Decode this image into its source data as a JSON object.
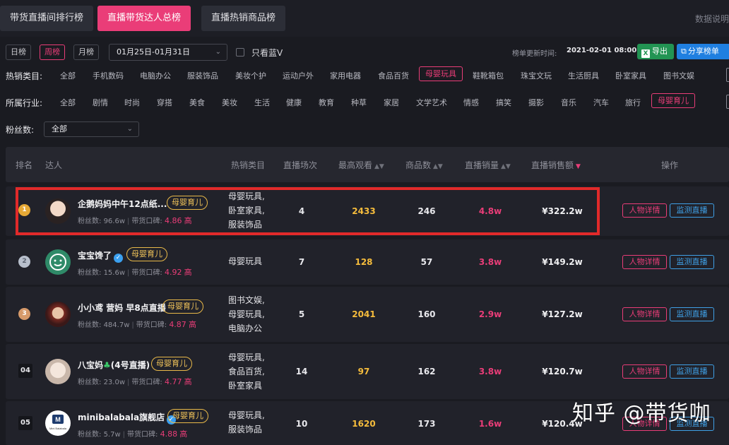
{
  "top_tabs": [
    {
      "label": "带货直播间排行榜",
      "active": false
    },
    {
      "label": "直播带货达人总榜",
      "active": true
    },
    {
      "label": "直播热销商品榜",
      "active": false
    }
  ],
  "top_right_text": "数据说明",
  "period_tabs": [
    {
      "label": "日榜",
      "active": false
    },
    {
      "label": "周榜",
      "active": true
    },
    {
      "label": "月榜",
      "active": false
    }
  ],
  "date_range": "01月25日-01月31日",
  "only_blue_v": "只看蓝V",
  "update_label": "榜单更新时间:",
  "update_value": "2021-02-01 08:00",
  "export_label": "导出",
  "share_label": "分享榜单",
  "hot_category": {
    "label": "热销类目:",
    "items": [
      "全部",
      "手机数码",
      "电脑办公",
      "服装饰品",
      "美妆个护",
      "运动户外",
      "家用电器",
      "食品百货",
      "母婴玩具",
      "鞋靴箱包",
      "珠宝文玩",
      "生活厨具",
      "卧室家具",
      "图书文娱"
    ],
    "active": "母婴玩具"
  },
  "industry": {
    "label": "所属行业:",
    "items": [
      "全部",
      "剧情",
      "时尚",
      "穿搭",
      "美食",
      "美妆",
      "生活",
      "健康",
      "教育",
      "种草",
      "家居",
      "文学艺术",
      "情感",
      "搞笑",
      "摄影",
      "音乐",
      "汽车",
      "旅行",
      "母婴育儿"
    ],
    "active": "母婴育儿"
  },
  "fans_filter": {
    "label": "粉丝数:",
    "value": "全部"
  },
  "table": {
    "headers": {
      "rank": "排名",
      "influencer": "达人",
      "categories": "热销类目",
      "sessions": "直播场次",
      "max_viewers": "最高观看",
      "goods": "商品数",
      "sales": "直播销量",
      "amount": "直播销售额",
      "actions": "操作"
    },
    "fans_prefix": "粉丝数:",
    "rep_prefix": "带货口碑:",
    "detail_label": "人物详情",
    "monitor_label": "监测直播",
    "rows": [
      {
        "rank": "1",
        "name": "企鹅妈妈中午12点纸...",
        "badge": "母婴育儿",
        "fans": "96.6w",
        "rep_score": "4.86",
        "rep_level": "高",
        "cats": [
          "母婴玩具,",
          "卧室家具,",
          "服装饰品"
        ],
        "sessions": "4",
        "max_viewers": "2433",
        "goods": "246",
        "sales": "4.8w",
        "amount": "¥322.2w"
      },
      {
        "rank": "2",
        "name": "宝宝馋了",
        "badge": "母婴育儿",
        "fans": "15.6w",
        "rep_score": "4.92",
        "rep_level": "高",
        "cats": [
          "母婴玩具"
        ],
        "sessions": "7",
        "max_viewers": "128",
        "goods": "57",
        "sales": "3.8w",
        "amount": "¥149.2w"
      },
      {
        "rank": "3",
        "name": "小小鸢 营妈 早8点直播",
        "badge": "母婴育儿",
        "fans": "484.7w",
        "rep_score": "4.87",
        "rep_level": "高",
        "cats": [
          "图书文娱,",
          "母婴玩具,",
          "电脑办公"
        ],
        "sessions": "5",
        "max_viewers": "2041",
        "goods": "160",
        "sales": "2.9w",
        "amount": "¥127.2w"
      },
      {
        "rank": "04",
        "name_pre": "八宝妈",
        "name_post": "(4号直播)",
        "badge": "母婴育儿",
        "fans": "23.0w",
        "rep_score": "4.77",
        "rep_level": "高",
        "cats": [
          "母婴玩具,",
          "食品百货,",
          "卧室家具"
        ],
        "sessions": "14",
        "max_viewers": "97",
        "goods": "162",
        "sales": "3.8w",
        "amount": "¥120.7w"
      },
      {
        "rank": "05",
        "name": "minibalabala旗舰店",
        "badge": "母婴育儿",
        "fans": "5.7w",
        "rep_score": "4.88",
        "rep_level": "高",
        "cats": [
          "母婴玩具,",
          "服装饰品"
        ],
        "sessions": "10",
        "max_viewers": "1620",
        "goods": "173",
        "sales": "1.6w",
        "amount": "¥120.4w"
      }
    ]
  },
  "avatar_logo_text": "Mini Balabala",
  "watermark": "知乎 @带货咖",
  "colors": {
    "accent": "#ea3d78",
    "gold": "#f5bc3c",
    "blue": "#3fa0e6",
    "highlight": "#e12a2a"
  }
}
